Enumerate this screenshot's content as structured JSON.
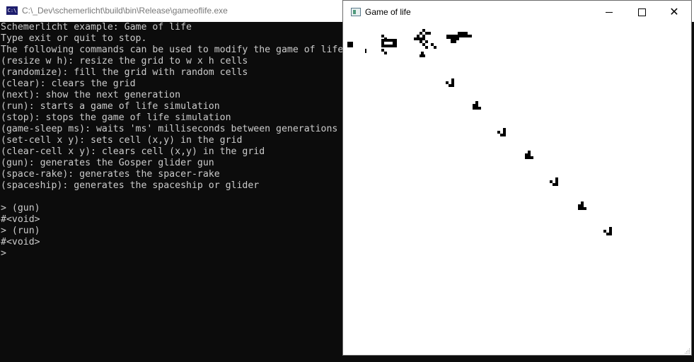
{
  "console": {
    "title": "C:\\_Dev\\schemerlicht\\build\\bin\\Release\\gameoflife.exe",
    "icon_text": "C:\\",
    "lines": [
      "Schemerlicht example: Game of life",
      "Type exit or quit to stop.",
      "The following commands can be used to modify the game of life:",
      "(resize w h): resize the grid to w x h cells",
      "(randomize): fill the grid with random cells",
      "(clear): clears the grid",
      "(next): show the next generation",
      "(run): starts a game of life simulation",
      "(stop): stops the game of life simulation",
      "(game-sleep ms): waits 'ms' milliseconds between generations",
      "(set-cell x y): sets cell (x,y) in the grid",
      "(clear-cell x y): clears cell (x,y) in the grid",
      "(gun): generates the Gosper glider gun",
      "(space-rake): generates the spacer-rake",
      "(spaceship): generates the spaceship or glider",
      "",
      "> (gun)",
      "#<void>",
      "> (run)",
      "#<void>",
      ">"
    ]
  },
  "game_window": {
    "title": "Game of life",
    "minimize_icon": "minimize-icon",
    "maximize_icon": "maximize-icon",
    "close_icon": "close-icon",
    "close_glyph": "✕"
  },
  "colors": {
    "console_bg": "#0c0c0c",
    "console_text": "#cccccc",
    "cell": "#000000",
    "grid_bg": "#ffffff"
  }
}
